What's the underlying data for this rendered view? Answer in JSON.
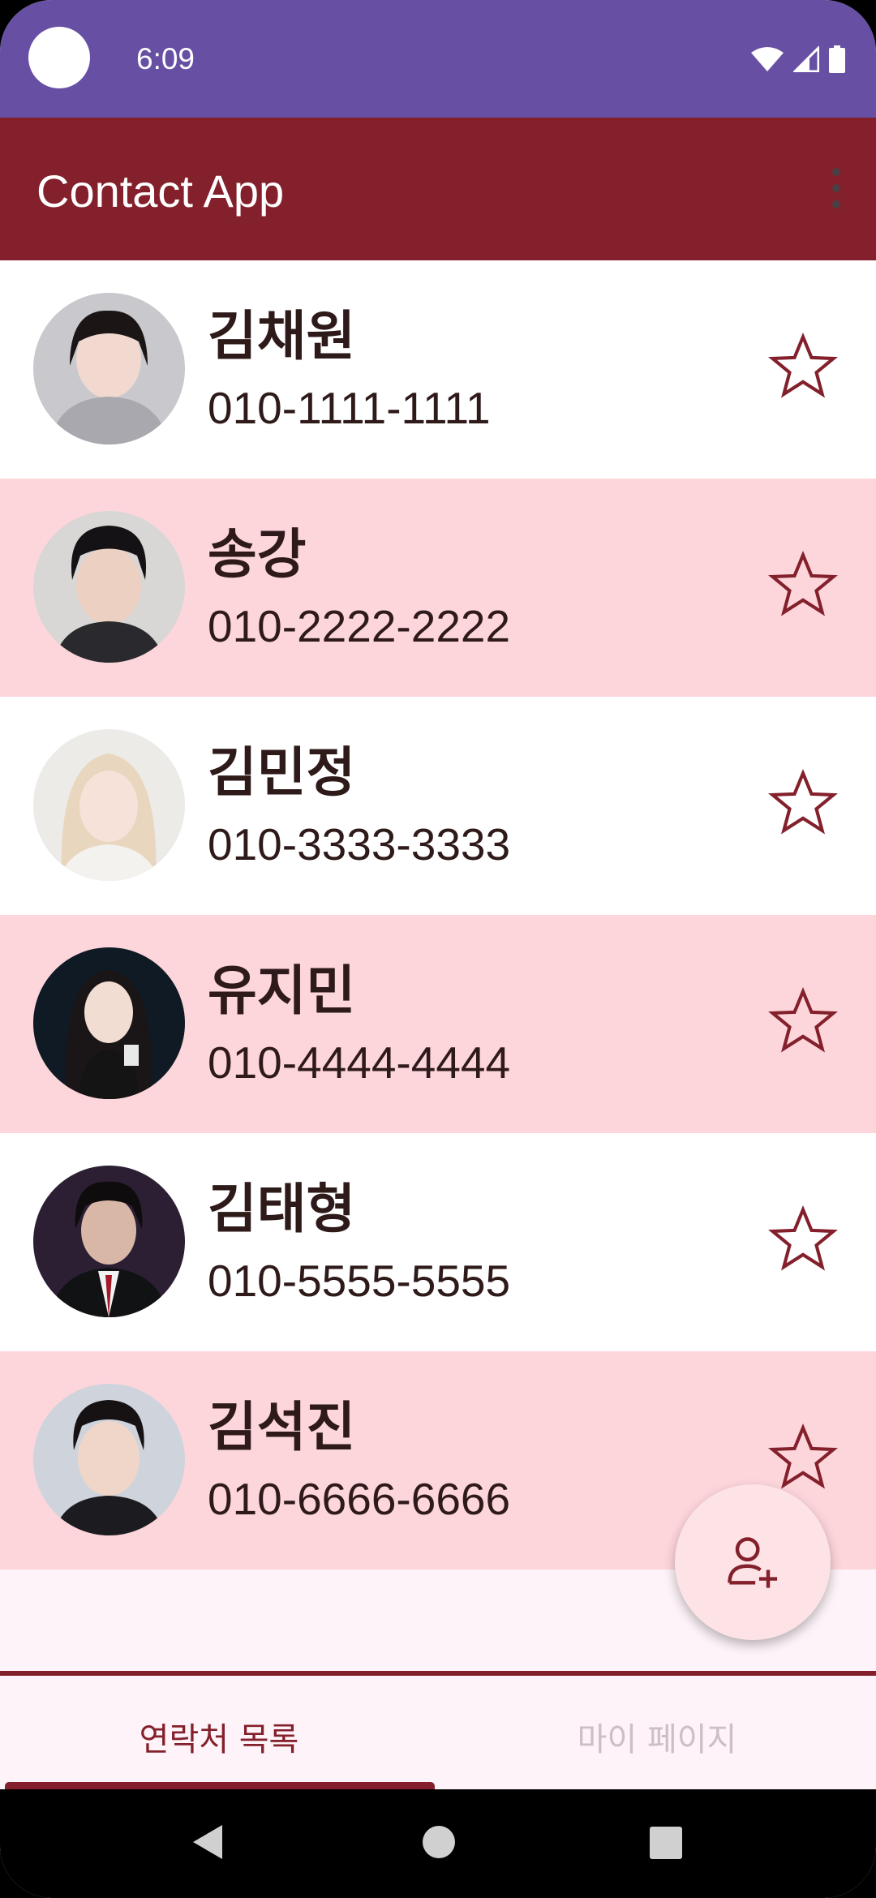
{
  "status_bar": {
    "time": "6:09",
    "icons": [
      "wifi-icon",
      "signal-icon",
      "battery-icon"
    ]
  },
  "app_bar": {
    "title": "Contact App",
    "menu_icon": "more-vert-icon"
  },
  "contacts": [
    {
      "name": "김채원",
      "phone": "010-1111-1111",
      "favorite": false
    },
    {
      "name": "송강",
      "phone": "010-2222-2222",
      "favorite": false
    },
    {
      "name": "김민정",
      "phone": "010-3333-3333",
      "favorite": false
    },
    {
      "name": "유지민",
      "phone": "010-4444-4444",
      "favorite": false
    },
    {
      "name": "김태형",
      "phone": "010-5555-5555",
      "favorite": false
    },
    {
      "name": "김석진",
      "phone": "010-6666-6666",
      "favorite": false
    }
  ],
  "fab": {
    "icon": "add-person-icon"
  },
  "tabs": [
    {
      "label": "연락처 목록",
      "active": true
    },
    {
      "label": "마이 페이지",
      "active": false
    }
  ],
  "nav_bar": {
    "icons": [
      "back-icon",
      "home-icon",
      "recents-icon"
    ]
  },
  "colors": {
    "status_bar": "#6750A4",
    "app_bar": "#83202b",
    "row_alt": "#fdd6db",
    "accent": "#83202b",
    "fab": "#fde3e6"
  }
}
